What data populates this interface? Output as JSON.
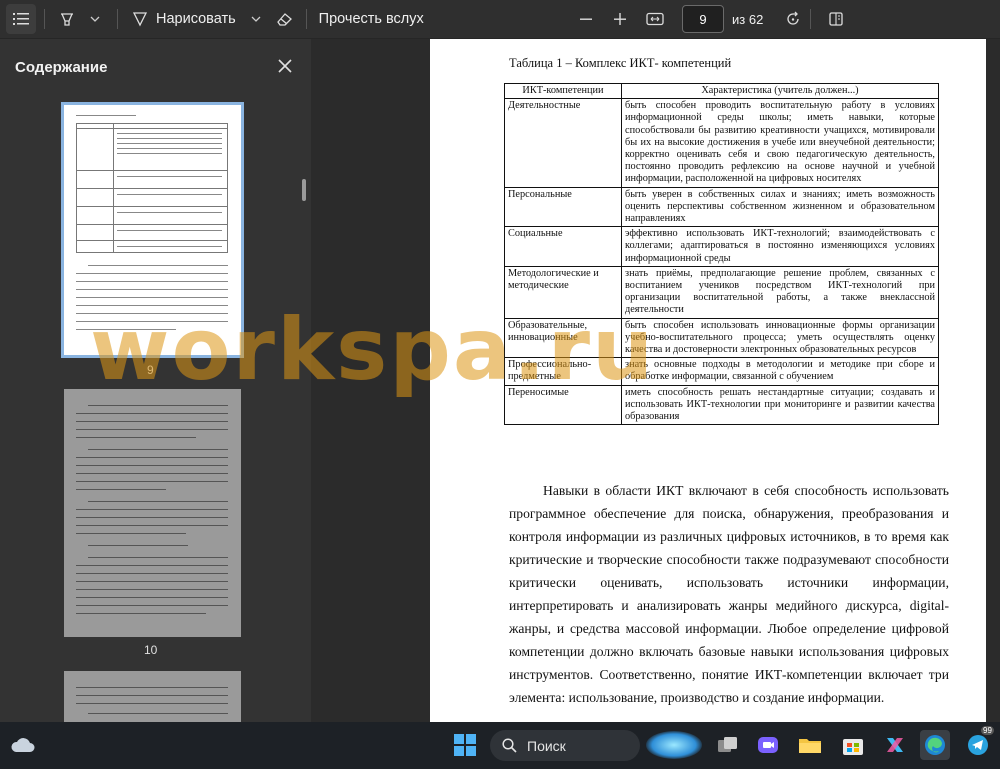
{
  "toolbar": {
    "draw_label": "Нарисовать",
    "read_aloud_label": "Прочесть вслух",
    "page_current": "9",
    "page_total": "из 62"
  },
  "sidebar": {
    "title": "Содержание",
    "thumbs": [
      {
        "number": "9",
        "selected": true
      },
      {
        "number": "10",
        "selected": false
      }
    ]
  },
  "document": {
    "table_caption": "Таблица 1 – Комплекс ИКТ- компетенций",
    "table_headers": [
      "ИКТ-компетенции",
      "Характеристика (учитель должен...)"
    ],
    "table_rows": [
      {
        "category": "Деятельностные",
        "description": "быть способен проводить воспитательную работу в условиях информационной среды школы; иметь навыки, которые способствовали бы развитию креативности учащихся, мотивировали бы их на высокие достижения в учебе или внеучебной деятельности; корректно оценивать себя и свою педагогическую деятельность, постоянно проводить рефлексию на основе научной и учебной информации, расположенной на цифровых носителях"
      },
      {
        "category": "Персональные",
        "description": "быть уверен в собственных силах и знаниях; иметь возможность оценить перспективы собственном жизненном и образовательном направлениях"
      },
      {
        "category": "Социальные",
        "description": "эффективно использовать ИКТ-технологий; взаимодействовать с коллегами; адаптироваться в постоянно изменяющихся условиях информационной среды"
      },
      {
        "category": "Методологические и методические",
        "description": "знать приёмы, предполагающие решение проблем, связанных с воспитанием учеников посредством ИКТ-технологий при организации воспитательной работы, а также внеклассной деятельности"
      },
      {
        "category": "Образовательные, инновационные",
        "description": "быть способен использовать инновационные формы организации учебно-воспитательного процесса; уметь осуществлять оценку качества и достоверности электронных образовательных ресурсов"
      },
      {
        "category": "Профессионально-предметные",
        "description": "знать основные подходы в методологии и методике при сборе и обработке информации, связанной с обучением"
      },
      {
        "category": "Переносимые",
        "description": "иметь способность решать нестандартные ситуации; создавать и использовать ИКТ-технологии при мониторинге и развитии качества образования"
      }
    ],
    "paragraph": "Навыки в области ИКТ включают в себя способность использовать программное обеспечение для поиска, обнаружения, преобразования и контроля информации из различных цифровых источников, в то время как критические и творческие способности также подразумевают способности критически оценивать, использовать источники информации, интерпретировать и анализировать жанры медийного дискурса, digital-жанры, и средства массовой информации. Любое определение цифровой компетенции должно включать базовые навыки использования цифровых инструментов. Соответственно, понятие ИКТ-компетенции включает три элемента: использование, производство и создание информации."
  },
  "watermark": {
    "text": "workspa.ru",
    "color": "#dd9614"
  },
  "taskbar": {
    "search_label": "Поиск",
    "telegram_badge": "99"
  },
  "colors": {
    "accent": "#8ab4e0",
    "toolbar_bg": "#2f2f2f",
    "sidebar_bg": "#333333"
  }
}
